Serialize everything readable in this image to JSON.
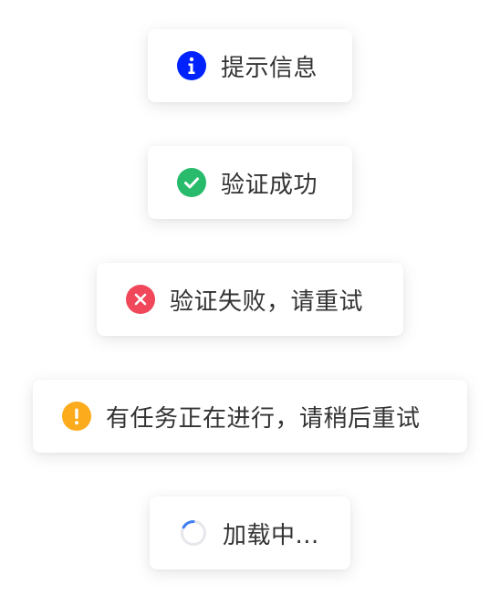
{
  "toasts": {
    "info": {
      "message": "提示信息",
      "icon": "info-icon",
      "color": "#0022ff"
    },
    "success": {
      "message": "验证成功",
      "icon": "check-circle-icon",
      "color": "#27bb6b"
    },
    "error": {
      "message": "验证失败，请重试",
      "icon": "close-circle-icon",
      "color": "#f0475a"
    },
    "warning": {
      "message": "有任务正在进行，请稍后重试",
      "icon": "exclamation-circle-icon",
      "color": "#fbab1c"
    },
    "loading": {
      "message": "加载中...",
      "icon": "loading-spinner-icon",
      "color": "#3d7ef5",
      "track_color": "#e5e7eb"
    }
  }
}
